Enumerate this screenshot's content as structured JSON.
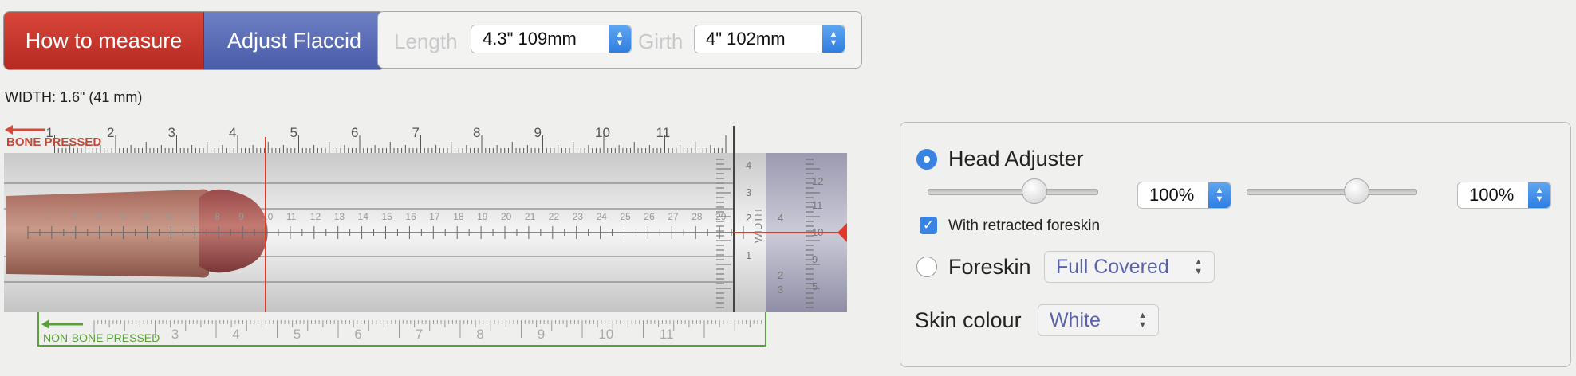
{
  "buttons": {
    "how_to_measure": "How to measure",
    "adjust_flaccid": "Adjust Flaccid"
  },
  "dimensions": {
    "length_label": "Length",
    "length_value": "4.3\" 109mm",
    "girth_label": "Girth",
    "girth_value": "4\" 102mm"
  },
  "width_text": "WIDTH: 1.6\" (41 mm)",
  "ruler": {
    "bone_pressed": "BONE PRESSED",
    "non_bone_pressed": "NON-BONE PRESSED",
    "top_inches": [
      "1",
      "2",
      "3",
      "4",
      "5",
      "6",
      "7",
      "8",
      "9",
      "10",
      "11"
    ],
    "bottom_inches": [
      "3",
      "4",
      "5",
      "6",
      "7",
      "8",
      "9",
      "10",
      "11"
    ],
    "cm_marks": [
      "1",
      "2",
      "3",
      "4",
      "5",
      "6",
      "7",
      "8",
      "9",
      "10",
      "11",
      "12",
      "13",
      "14",
      "15",
      "16",
      "17",
      "18",
      "19",
      "20",
      "21",
      "22",
      "23",
      "24",
      "25",
      "26",
      "27",
      "28",
      "29"
    ],
    "width_label": "WIDTH",
    "side_marks": [
      "4",
      "3",
      "2",
      "1",
      "4",
      "2",
      "3",
      "12",
      "11",
      "10",
      "9",
      "5",
      "4",
      "3"
    ],
    "colors": {
      "bone": "#d64a3a",
      "non_bone": "#5aa03a",
      "marker": "#e03a2a"
    }
  },
  "panel": {
    "head_adjuster_label": "Head Adjuster",
    "head_select_1": "100%",
    "head_select_2": "100%",
    "retracted_label": "With retracted foreskin",
    "foreskin_label": "Foreskin",
    "foreskin_value": "Full Covered",
    "skin_colour_label": "Skin colour",
    "skin_colour_value": "White"
  }
}
